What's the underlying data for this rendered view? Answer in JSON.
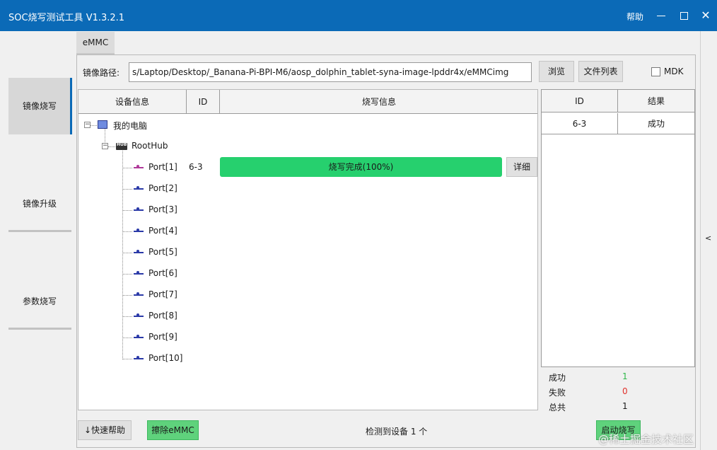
{
  "window": {
    "title": "SOC烧写测试工具 V1.3.2.1",
    "help": "帮助",
    "close": "✕"
  },
  "sidebar": {
    "items": [
      {
        "label": "镜像烧写",
        "active": true
      },
      {
        "label": "镜像升级",
        "active": false
      },
      {
        "label": "参数烧写",
        "active": false
      }
    ]
  },
  "tabs": [
    {
      "label": "eMMC"
    }
  ],
  "path": {
    "label": "镜像路径:",
    "value": "s/Laptop/Desktop/_Banana-Pi-BPI-M6/aosp_dolphin_tablet-syna-image-lpddr4x/eMMCimg"
  },
  "buttons": {
    "browse": "浏览",
    "file_list": "文件列表",
    "detail": "详细",
    "quick_help": "↓快速帮助",
    "erase": "擦除eMMC",
    "start": "启动烧写"
  },
  "mdk": {
    "label": "MDK",
    "checked": false
  },
  "tree": {
    "headers": {
      "device": "设备信息",
      "id": "ID",
      "info": "烧写信息"
    },
    "computer": "我的电脑",
    "hub": "RootHub",
    "ports": [
      {
        "label": "Port[1]",
        "id": "6-3",
        "progress_text": "烧写完成(100%)",
        "progress": 100
      },
      {
        "label": "Port[2]"
      },
      {
        "label": "Port[3]"
      },
      {
        "label": "Port[4]"
      },
      {
        "label": "Port[5]"
      },
      {
        "label": "Port[6]"
      },
      {
        "label": "Port[7]"
      },
      {
        "label": "Port[8]"
      },
      {
        "label": "Port[9]"
      },
      {
        "label": "Port[10]"
      }
    ]
  },
  "results": {
    "headers": {
      "id": "ID",
      "result": "结果"
    },
    "rows": [
      {
        "id": "6-3",
        "result": "成功"
      }
    ]
  },
  "stats": {
    "success_label": "成功",
    "success": "1",
    "fail_label": "失败",
    "fail": "0",
    "total_label": "总共",
    "total": "1",
    "success_color": "#2fb84a",
    "fail_color": "#e0302a"
  },
  "status": "检测到设备 1 个",
  "collapse": "<",
  "watermark": "@稀土掘金技术社区",
  "colors": {
    "accent": "#0b6ab7",
    "progress": "#26d06e",
    "action_button": "#5fd27c"
  }
}
